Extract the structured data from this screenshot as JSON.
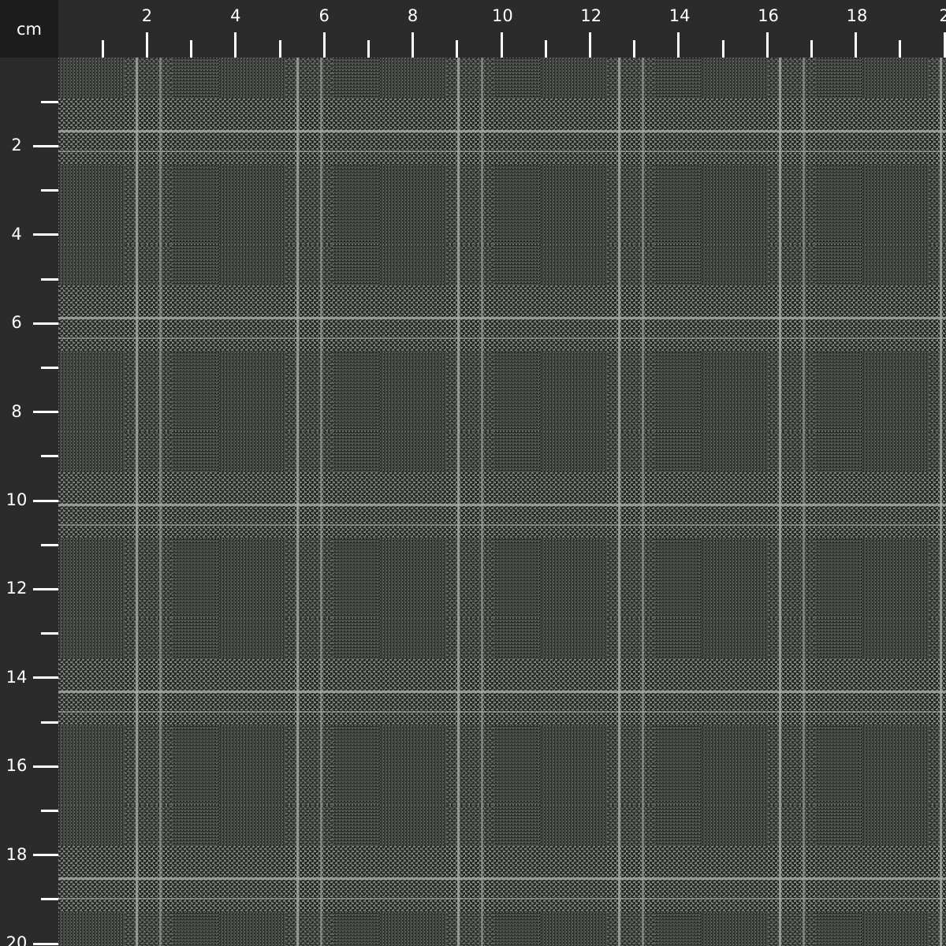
{
  "ruler": {
    "unit_label": "cm",
    "top_labels": [
      "2",
      "4",
      "6",
      "8",
      "10",
      "12",
      "14",
      "16",
      "18",
      "2"
    ],
    "left_labels": [
      "2",
      "4",
      "6",
      "8",
      "10",
      "12",
      "14",
      "16",
      "18",
      "20"
    ]
  },
  "fabric": {
    "pattern": "glen-check",
    "base_color": "#4e524e",
    "dark_color": "#1f241f",
    "light_color": "#9a9e9a"
  }
}
